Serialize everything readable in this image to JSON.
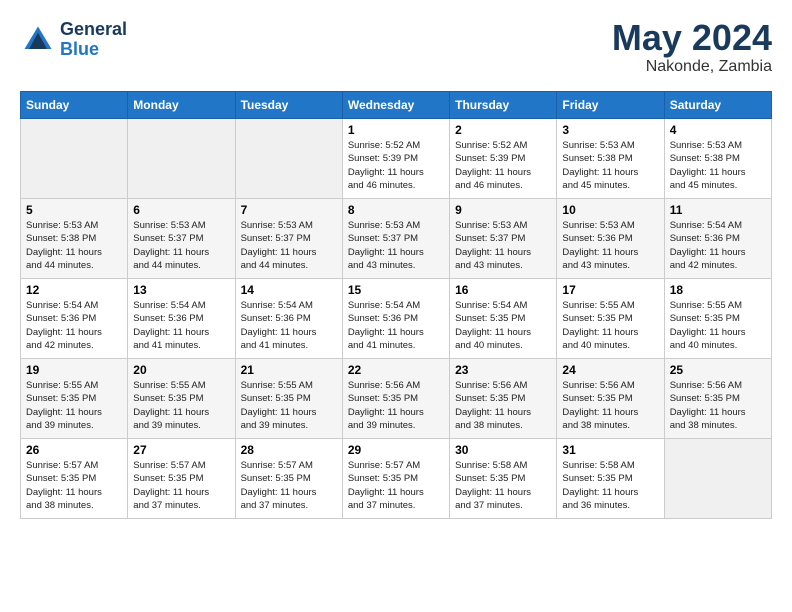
{
  "header": {
    "logo_line1": "General",
    "logo_line2": "Blue",
    "month": "May 2024",
    "location": "Nakonde, Zambia"
  },
  "weekdays": [
    "Sunday",
    "Monday",
    "Tuesday",
    "Wednesday",
    "Thursday",
    "Friday",
    "Saturday"
  ],
  "weeks": [
    [
      {
        "day": "",
        "info": ""
      },
      {
        "day": "",
        "info": ""
      },
      {
        "day": "",
        "info": ""
      },
      {
        "day": "1",
        "info": "Sunrise: 5:52 AM\nSunset: 5:39 PM\nDaylight: 11 hours\nand 46 minutes."
      },
      {
        "day": "2",
        "info": "Sunrise: 5:52 AM\nSunset: 5:39 PM\nDaylight: 11 hours\nand 46 minutes."
      },
      {
        "day": "3",
        "info": "Sunrise: 5:53 AM\nSunset: 5:38 PM\nDaylight: 11 hours\nand 45 minutes."
      },
      {
        "day": "4",
        "info": "Sunrise: 5:53 AM\nSunset: 5:38 PM\nDaylight: 11 hours\nand 45 minutes."
      }
    ],
    [
      {
        "day": "5",
        "info": "Sunrise: 5:53 AM\nSunset: 5:38 PM\nDaylight: 11 hours\nand 44 minutes."
      },
      {
        "day": "6",
        "info": "Sunrise: 5:53 AM\nSunset: 5:37 PM\nDaylight: 11 hours\nand 44 minutes."
      },
      {
        "day": "7",
        "info": "Sunrise: 5:53 AM\nSunset: 5:37 PM\nDaylight: 11 hours\nand 44 minutes."
      },
      {
        "day": "8",
        "info": "Sunrise: 5:53 AM\nSunset: 5:37 PM\nDaylight: 11 hours\nand 43 minutes."
      },
      {
        "day": "9",
        "info": "Sunrise: 5:53 AM\nSunset: 5:37 PM\nDaylight: 11 hours\nand 43 minutes."
      },
      {
        "day": "10",
        "info": "Sunrise: 5:53 AM\nSunset: 5:36 PM\nDaylight: 11 hours\nand 43 minutes."
      },
      {
        "day": "11",
        "info": "Sunrise: 5:54 AM\nSunset: 5:36 PM\nDaylight: 11 hours\nand 42 minutes."
      }
    ],
    [
      {
        "day": "12",
        "info": "Sunrise: 5:54 AM\nSunset: 5:36 PM\nDaylight: 11 hours\nand 42 minutes."
      },
      {
        "day": "13",
        "info": "Sunrise: 5:54 AM\nSunset: 5:36 PM\nDaylight: 11 hours\nand 41 minutes."
      },
      {
        "day": "14",
        "info": "Sunrise: 5:54 AM\nSunset: 5:36 PM\nDaylight: 11 hours\nand 41 minutes."
      },
      {
        "day": "15",
        "info": "Sunrise: 5:54 AM\nSunset: 5:36 PM\nDaylight: 11 hours\nand 41 minutes."
      },
      {
        "day": "16",
        "info": "Sunrise: 5:54 AM\nSunset: 5:35 PM\nDaylight: 11 hours\nand 40 minutes."
      },
      {
        "day": "17",
        "info": "Sunrise: 5:55 AM\nSunset: 5:35 PM\nDaylight: 11 hours\nand 40 minutes."
      },
      {
        "day": "18",
        "info": "Sunrise: 5:55 AM\nSunset: 5:35 PM\nDaylight: 11 hours\nand 40 minutes."
      }
    ],
    [
      {
        "day": "19",
        "info": "Sunrise: 5:55 AM\nSunset: 5:35 PM\nDaylight: 11 hours\nand 39 minutes."
      },
      {
        "day": "20",
        "info": "Sunrise: 5:55 AM\nSunset: 5:35 PM\nDaylight: 11 hours\nand 39 minutes."
      },
      {
        "day": "21",
        "info": "Sunrise: 5:55 AM\nSunset: 5:35 PM\nDaylight: 11 hours\nand 39 minutes."
      },
      {
        "day": "22",
        "info": "Sunrise: 5:56 AM\nSunset: 5:35 PM\nDaylight: 11 hours\nand 39 minutes."
      },
      {
        "day": "23",
        "info": "Sunrise: 5:56 AM\nSunset: 5:35 PM\nDaylight: 11 hours\nand 38 minutes."
      },
      {
        "day": "24",
        "info": "Sunrise: 5:56 AM\nSunset: 5:35 PM\nDaylight: 11 hours\nand 38 minutes."
      },
      {
        "day": "25",
        "info": "Sunrise: 5:56 AM\nSunset: 5:35 PM\nDaylight: 11 hours\nand 38 minutes."
      }
    ],
    [
      {
        "day": "26",
        "info": "Sunrise: 5:57 AM\nSunset: 5:35 PM\nDaylight: 11 hours\nand 38 minutes."
      },
      {
        "day": "27",
        "info": "Sunrise: 5:57 AM\nSunset: 5:35 PM\nDaylight: 11 hours\nand 37 minutes."
      },
      {
        "day": "28",
        "info": "Sunrise: 5:57 AM\nSunset: 5:35 PM\nDaylight: 11 hours\nand 37 minutes."
      },
      {
        "day": "29",
        "info": "Sunrise: 5:57 AM\nSunset: 5:35 PM\nDaylight: 11 hours\nand 37 minutes."
      },
      {
        "day": "30",
        "info": "Sunrise: 5:58 AM\nSunset: 5:35 PM\nDaylight: 11 hours\nand 37 minutes."
      },
      {
        "day": "31",
        "info": "Sunrise: 5:58 AM\nSunset: 5:35 PM\nDaylight: 11 hours\nand 36 minutes."
      },
      {
        "day": "",
        "info": ""
      }
    ]
  ]
}
